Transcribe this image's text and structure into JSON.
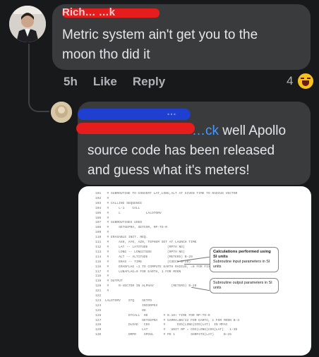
{
  "comment": {
    "author_visible": "Rich… …k",
    "text_lines": [
      "Metric system ain't get you to the",
      "moon tho did it"
    ],
    "time": "5h",
    "like_label": "Like",
    "reply_label": "Reply",
    "reaction_count": "4",
    "reaction_icon": "laughing-emoji-icon"
  },
  "reply": {
    "author_visible": "…",
    "mention_visible": "…ck",
    "text_lines": [
      " well Apollo",
      "source code has been released",
      "and guess what it's meters!"
    ]
  },
  "attachment": {
    "code_lines": [
      "101   # SUBROUTINE TO CONVERT LAT,LONG,ALT AT GIVEN TIME TO RADIUS VECTOR",
      "102   #",
      "103   # CALLING SEQUENCE",
      "104   #     L-1    CALL",
      "105   #     L             LALOTORV",
      "106   #",
      "107   # SUBROUTINES USED",
      "108   #     SETGEPRA, SETCOR, RP-TO-R",
      "109   #",
      "110   # ERASABLE INIT. REQ.",
      "111   #     AX0, AY0, AZ0, TEPHEM SET AT LAUNCH TIME",
      "112   #     LAT -- LATITUDE          (RPTH ND)",
      "113   #     LONG -- LONGITUDE        (RPTH ND)",
      "114   #     ALT -- ALTITUDE          (METERS) B-29",
      "115   #     ERAS -- TIME             (CSECS B-28)",
      "116   #     ERADFLAG =1 TO COMPUTE EARTH RADIUS, =0 FOR FIXED EARTH RADIUS",
      "117   #     LUNAFLAG=0 FOR EARTH, 1 FOR MOON",
      "118   #",
      "119   # OUTPUT",
      "120   #     R-VECTOR IN ALPHAV         (METERS) B-29",
      "121   #",
      "122",
      "123  LALOTORV    STQ    SETPD",
      "124                     INCORPEX",
      "125                     0D",
      "126              DTCALL  0D        # 0.10+ TIME FOR RP-TO-R",
      "127                     SETGEPRA   # GAMMA=B0/42 FOR EARTH, 1 FOR MOON B-3",
      "128              DLOAD   CDS       #      COS(LONG)COS(LAT)  IN MPAC",
      "129                     LAT        #   UNIT RP = COS(LONG)COS(LAT)   1-3D",
      "130              DMPR    SPOSL     # PD 1        SHRP4TS(LAT)     B-25"
    ],
    "callout1_title": "Calculations performed using SI units",
    "callout1_sub": "Subroutine input parameters in SI units",
    "callout2_sub": "Subroutine output parameters in SI units"
  }
}
